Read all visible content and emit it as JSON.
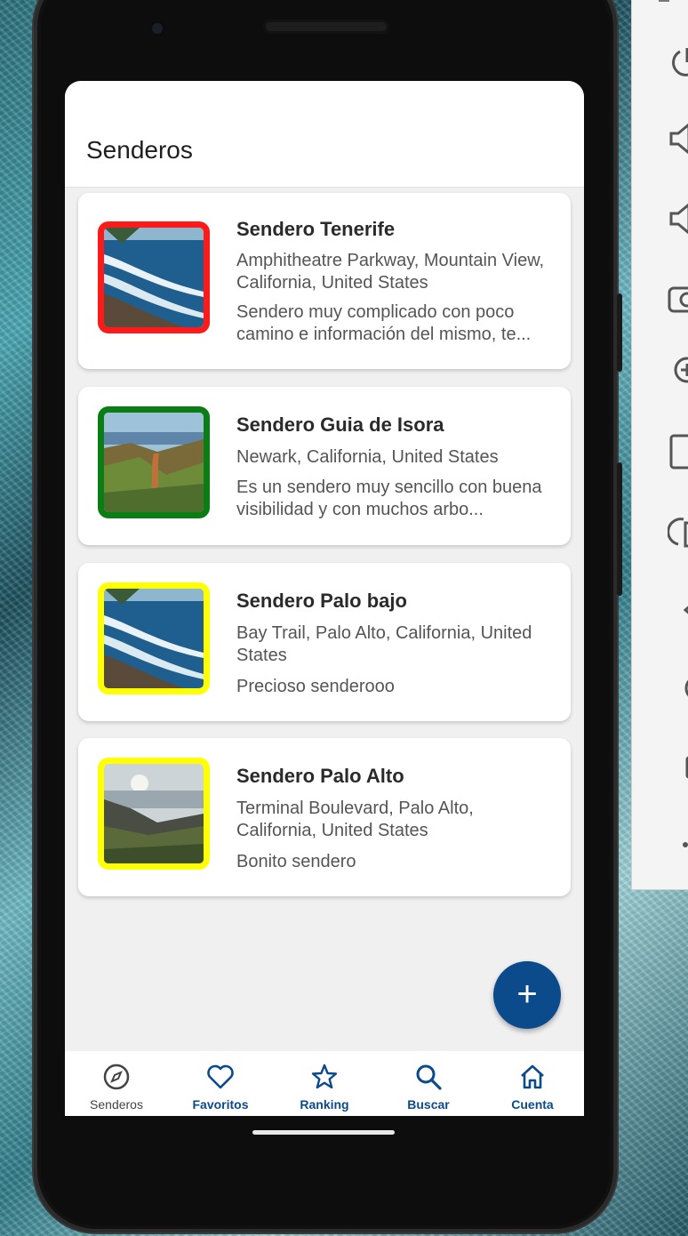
{
  "app": {
    "title": "Senderos"
  },
  "trails": [
    {
      "name": "Sendero Tenerife",
      "location": "Amphitheatre Parkway, Mountain View, California, United States",
      "description": "Sendero muy complicado con poco camino e información del mismo, te...",
      "border_color": "#ff1a1a",
      "image": "ocean-coast"
    },
    {
      "name": "Sendero Guia de Isora",
      "location": "Newark, California, United States",
      "description": "Es un sendero muy sencillo con buena visibilidad y con muchos arbo...",
      "border_color": "#0a7d14",
      "image": "mountain-path"
    },
    {
      "name": "Sendero Palo bajo",
      "location": "Bay Trail, Palo Alto, California, United States",
      "description": "Precioso senderooo",
      "border_color": "#ffff00",
      "image": "ocean-coast"
    },
    {
      "name": "Sendero Palo Alto",
      "location": "Terminal Boulevard, Palo Alto, California, United States",
      "description": "Bonito sendero",
      "border_color": "#ffff00",
      "image": "valley-sunset"
    }
  ],
  "fab": {
    "label": "+"
  },
  "bottom_nav": [
    {
      "label": "Senderos",
      "icon": "compass-icon",
      "active": false
    },
    {
      "label": "Favoritos",
      "icon": "heart-icon",
      "active": true
    },
    {
      "label": "Ranking",
      "icon": "star-icon",
      "active": true
    },
    {
      "label": "Buscar",
      "icon": "search-icon",
      "active": true
    },
    {
      "label": "Cuenta",
      "icon": "home-icon",
      "active": true
    }
  ],
  "colors": {
    "primary": "#0b4a8b",
    "inactive": "#444444"
  },
  "emulator_toolbar": [
    "power-icon",
    "volume-up-icon",
    "volume-down-icon",
    "camera-icon",
    "zoom-in-icon",
    "rotate-icon",
    "rotate-right-icon",
    "back-icon",
    "home-circle-icon",
    "overview-icon",
    "more-icon"
  ]
}
